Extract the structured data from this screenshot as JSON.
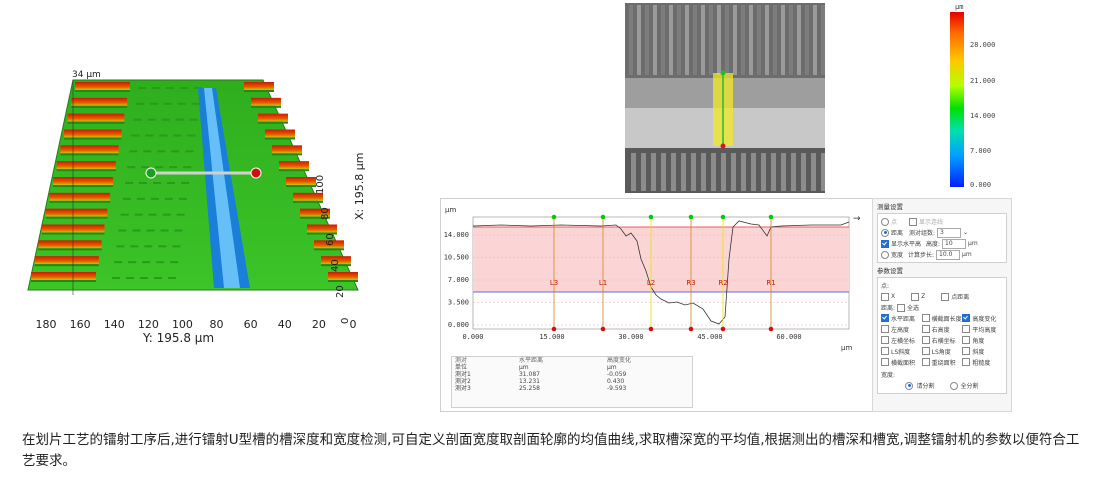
{
  "left_3d": {
    "z_label": "34 μm",
    "x_axis_label": "X: 195.8 μm",
    "x_ticks": [
      "0",
      "20",
      "40",
      "60",
      "80",
      "100"
    ],
    "y_axis_label": "Y: 195.8 μm",
    "y_ticks": [
      "180",
      "160",
      "140",
      "120",
      "100",
      "80",
      "60",
      "40",
      "20",
      "0"
    ]
  },
  "colorbar": {
    "unit": "μm",
    "ticks": [
      "28.000",
      "21.000",
      "14.000",
      "7.000",
      "0.000"
    ],
    "colors": [
      "#e60000",
      "#ffc800",
      "#00e000",
      "#00a0ff",
      "#0020ff"
    ]
  },
  "profile": {
    "unit_y": "μm",
    "unit_x": "μm",
    "y_ticks": [
      "14.000",
      "10.500",
      "7.000",
      "3.500",
      "0.000"
    ],
    "x_ticks": [
      "0.000",
      "15.000",
      "30.000",
      "45.000",
      "60.000"
    ],
    "markers": [
      "L3",
      "L1",
      "L2",
      "R3",
      "R2",
      "R1"
    ],
    "marker_color": "#00cc00"
  },
  "results_table": {
    "headers": [
      "测对",
      "水平距离",
      "高度变化"
    ],
    "unit_row": [
      "单位",
      "μm",
      "μm"
    ],
    "rows": [
      [
        "测对1",
        "31.087",
        "-0.059"
      ],
      [
        "测对2",
        "13.231",
        "0.430"
      ],
      [
        "测对3",
        "25.258",
        "-9.593"
      ]
    ]
  },
  "settings": {
    "measure_title": "测量设置",
    "point_label": "点",
    "show_lines_label": "显示连线",
    "distance_label": "距离",
    "pairs_label": "测对组数:",
    "pairs_value": "3",
    "show_horizontal_label": "显示水平高",
    "height_label": "高度:",
    "height_value": "10",
    "width_label": "宽度",
    "step_label": "计算步长:",
    "step_value": "10.0",
    "unit": "μm",
    "params_title": "参数设置",
    "point_row_label": "点:",
    "x_label": "X",
    "z_label": "Z",
    "point_distance_label": "点距离",
    "distance_row_label": "距离:",
    "select_all_label": "全选",
    "params": [
      {
        "label": "水平距离",
        "checked": true
      },
      {
        "label": "横截面长度",
        "checked": false
      },
      {
        "label": "高度变化",
        "checked": true
      },
      {
        "label": "左高度",
        "checked": false
      },
      {
        "label": "右高度",
        "checked": false
      },
      {
        "label": "平均高度",
        "checked": false
      },
      {
        "label": "左横坐标",
        "checked": false
      },
      {
        "label": "右横坐标",
        "checked": false
      },
      {
        "label": "角度",
        "checked": false
      },
      {
        "label": "LS斜度",
        "checked": false
      },
      {
        "label": "LS角度",
        "checked": false
      },
      {
        "label": "斜度",
        "checked": false
      },
      {
        "label": "横截面积",
        "checked": false
      },
      {
        "label": "重绕面积",
        "checked": false
      },
      {
        "label": "粗糙度",
        "checked": false
      }
    ],
    "width_row_label": "宽度:",
    "width_option_1": "请分割",
    "width_option_2": "全分割"
  },
  "caption": "在划片工艺的镭射工序后,进行镭射U型槽的槽深度和宽度检测,可自定义剖面宽度取剖面轮廓的均值曲线,求取槽深宽的平均值,根据测出的槽深和槽宽,调整镭射机的参数以便符合工艺要求。"
}
